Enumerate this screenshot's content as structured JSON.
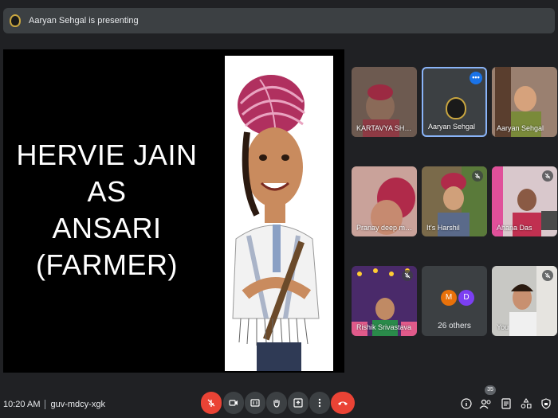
{
  "presenting": {
    "text": "Aaryan Sehgal is presenting"
  },
  "slide": {
    "lines": [
      "HERVIE JAIN",
      "AS",
      "ANSARI",
      "(FARMER)"
    ]
  },
  "tiles": [
    {
      "name": "KARTAVYA SHAR…",
      "muted": false
    },
    {
      "name": "Aaryan Sehgal",
      "muted": false,
      "active": true
    },
    {
      "name": "Aaryan Sehgal",
      "muted": false
    },
    {
      "name": "Pranay deep mal…",
      "muted": false
    },
    {
      "name": "It's Harshil",
      "muted": true
    },
    {
      "name": "Ahana Das",
      "muted": true
    },
    {
      "name": "Rishik Srivastava",
      "muted": true
    },
    {
      "name": "26 others",
      "initials": [
        "M",
        "D"
      ]
    },
    {
      "name": "You",
      "muted": true
    }
  ],
  "footer": {
    "time": "10:20 AM",
    "meeting_code": "guv-mdcy-xgk",
    "participant_count": "35"
  },
  "colors": {
    "end_call": "#ea4335",
    "mic_off": "#ea4335",
    "active_border": "#8ab4f8",
    "background": "#202124"
  }
}
